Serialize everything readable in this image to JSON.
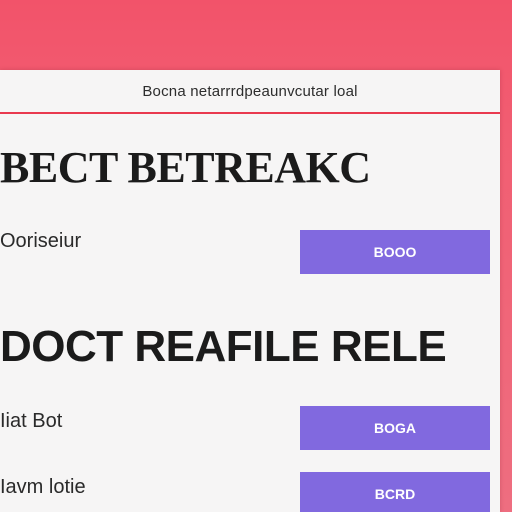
{
  "panel": {
    "header_text": "Bocna netarrrdpeaunvcutar loal"
  },
  "sections": [
    {
      "title": "BECT BETREAKC",
      "rows": [
        {
          "label": "Ooriseiur",
          "button_label": "BOOO"
        }
      ]
    },
    {
      "title": "DOCT REAFILE RELE",
      "rows": [
        {
          "label": "Iiat Bot",
          "button_label": "BOGA"
        },
        {
          "label": "Iavm lotie",
          "button_label": "BCRD"
        }
      ]
    }
  ],
  "colors": {
    "background": "#f2536a",
    "header_rule": "#e9394f",
    "button": "#8169df"
  }
}
